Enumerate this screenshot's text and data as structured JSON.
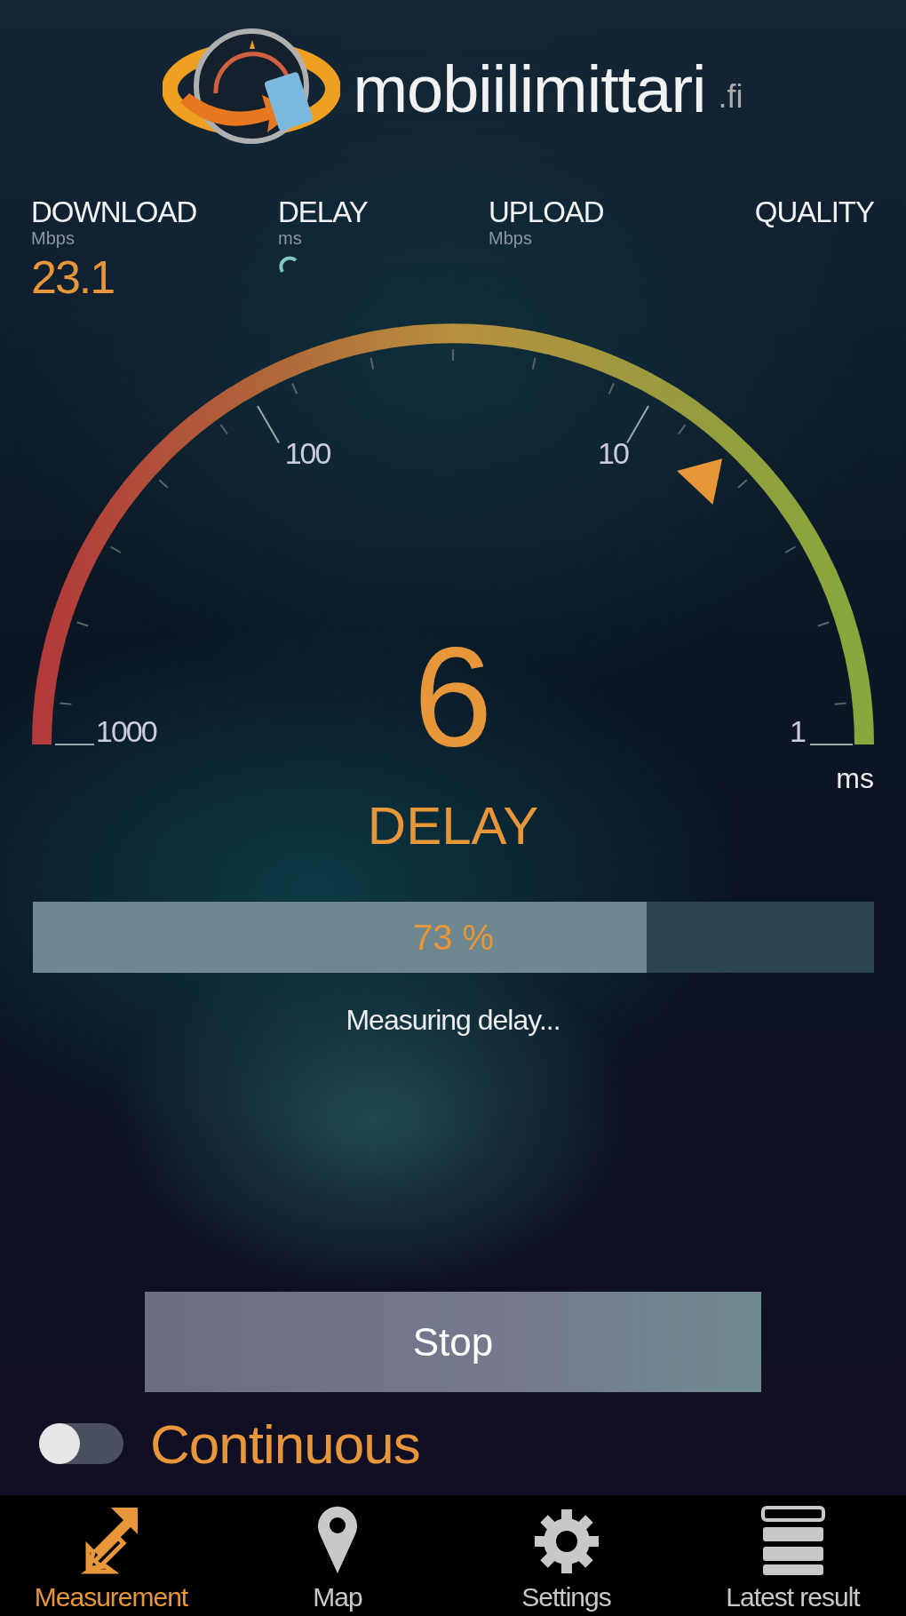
{
  "logo": {
    "name": "mobiilimittari",
    "suffix": ".fi"
  },
  "metrics": [
    {
      "label": "DOWNLOAD",
      "unit": "Mbps",
      "value": "23.1",
      "loading": false
    },
    {
      "label": "DELAY",
      "unit": "ms",
      "loading": true
    },
    {
      "label": "UPLOAD",
      "unit": "Mbps",
      "loading": false
    },
    {
      "label": "QUALITY",
      "loading": false
    }
  ],
  "gauge": {
    "reading": "6",
    "title": "DELAY",
    "unit": "ms",
    "scale_labels": [
      "1000",
      "100",
      "10",
      "1"
    ]
  },
  "progress": {
    "level": 0.73,
    "label": "73 %",
    "status": "Measuring delay..."
  },
  "stop_button": "Stop",
  "continuous": {
    "label": "Continuous",
    "on": false
  },
  "nav": [
    {
      "label": "Measurement",
      "kind": "measurement",
      "selected": true
    },
    {
      "label": "Map",
      "kind": "map",
      "selected": false
    },
    {
      "label": "Settings",
      "kind": "settings",
      "selected": false
    },
    {
      "label": "Latest result",
      "kind": "results",
      "selected": false
    }
  ]
}
